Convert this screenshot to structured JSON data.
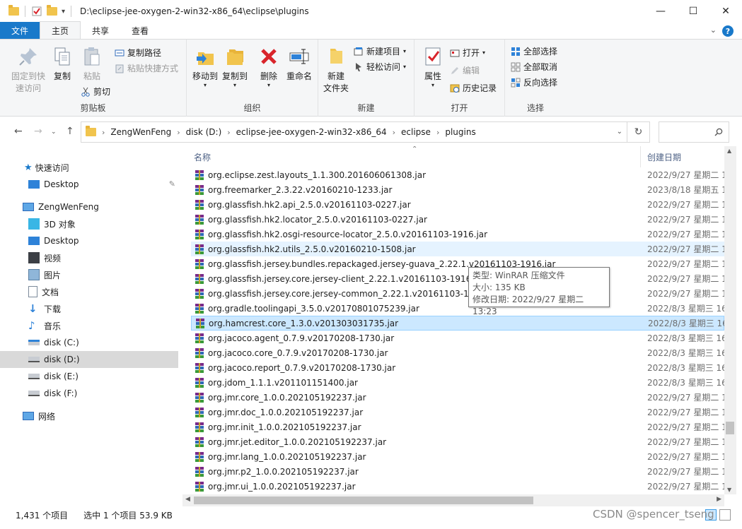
{
  "window": {
    "path": "D:\\eclipse-jee-oxygen-2-win32-x86_64\\eclipse\\plugins",
    "minimize": "—",
    "maximize": "☐",
    "close": "✕"
  },
  "tabs": {
    "file": "文件",
    "home": "主页",
    "share": "共享",
    "view": "查看",
    "help": "?"
  },
  "ribbon": {
    "clipboard": {
      "title": "剪贴板",
      "pin_line1": "固定到快",
      "pin_line2": "速访问",
      "copy": "复制",
      "paste": "粘贴",
      "copy_path": "复制路径",
      "paste_shortcut": "粘贴快捷方式",
      "cut": "剪切"
    },
    "organize": {
      "title": "组织",
      "move_to": "移动到",
      "copy_to": "复制到",
      "delete": "删除",
      "rename": "重命名"
    },
    "new": {
      "title": "新建",
      "new_folder_line1": "新建",
      "new_folder_line2": "文件夹",
      "new_item": "新建项目",
      "easy_access": "轻松访问"
    },
    "open": {
      "title": "打开",
      "properties": "属性",
      "open": "打开",
      "edit": "编辑",
      "history": "历史记录"
    },
    "select": {
      "title": "选择",
      "select_all": "全部选择",
      "select_none": "全部取消",
      "invert": "反向选择"
    }
  },
  "address": {
    "crumbs": [
      "ZengWenFeng",
      "disk (D:)",
      "eclipse-jee-oxygen-2-win32-x86_64",
      "eclipse",
      "plugins"
    ],
    "search_placeholder": ""
  },
  "nav": {
    "quick_access": "快速访问",
    "desktop_pinned": "Desktop",
    "this_pc": "ZengWenFeng",
    "objects3d": "3D 对象",
    "desktop": "Desktop",
    "videos": "视频",
    "pictures": "图片",
    "documents": "文档",
    "downloads": "下载",
    "music": "音乐",
    "disk_c": "disk (C:)",
    "disk_d": "disk (D:)",
    "disk_e": "disk (E:)",
    "disk_f": "disk (F:)",
    "network": "网络"
  },
  "columns": {
    "name": "名称",
    "created": "创建日期"
  },
  "files": [
    {
      "name": "org.eclipse.zest.layouts_1.1.300.201606061308.jar",
      "date": "2022/9/27 星期二 1"
    },
    {
      "name": "org.freemarker_2.3.22.v20160210-1233.jar",
      "date": "2023/8/18 星期五 1"
    },
    {
      "name": "org.glassfish.hk2.api_2.5.0.v20161103-0227.jar",
      "date": "2022/9/27 星期二 1"
    },
    {
      "name": "org.glassfish.hk2.locator_2.5.0.v20161103-0227.jar",
      "date": "2022/9/27 星期二 1"
    },
    {
      "name": "org.glassfish.hk2.osgi-resource-locator_2.5.0.v20161103-1916.jar",
      "date": "2022/9/27 星期二 1"
    },
    {
      "name": "org.glassfish.hk2.utils_2.5.0.v20160210-1508.jar",
      "date": "2022/9/27 星期二 1"
    },
    {
      "name": "org.glassfish.jersey.bundles.repackaged.jersey-guava_2.22.1.v20161103-1916.jar",
      "date": "2022/9/27 星期二 1"
    },
    {
      "name": "org.glassfish.jersey.core.jersey-client_2.22.1.v20161103-1916.jar",
      "date": "2022/9/27 星期二 1"
    },
    {
      "name": "org.glassfish.jersey.core.jersey-common_2.22.1.v20161103-1916.jar",
      "date": "2022/9/27 星期二 1"
    },
    {
      "name": "org.gradle.toolingapi_3.5.0.v20170801075239.jar",
      "date": "2022/8/3 星期三 16"
    },
    {
      "name": "org.hamcrest.core_1.3.0.v201303031735.jar",
      "date": "2022/8/3 星期三 16"
    },
    {
      "name": "org.jacoco.agent_0.7.9.v20170208-1730.jar",
      "date": "2022/8/3 星期三 16"
    },
    {
      "name": "org.jacoco.core_0.7.9.v20170208-1730.jar",
      "date": "2022/8/3 星期三 16"
    },
    {
      "name": "org.jacoco.report_0.7.9.v20170208-1730.jar",
      "date": "2022/8/3 星期三 16"
    },
    {
      "name": "org.jdom_1.1.1.v201101151400.jar",
      "date": "2022/8/3 星期三 16"
    },
    {
      "name": "org.jmr.core_1.0.0.202105192237.jar",
      "date": "2022/9/27 星期二 1"
    },
    {
      "name": "org.jmr.doc_1.0.0.202105192237.jar",
      "date": "2022/9/27 星期二 1"
    },
    {
      "name": "org.jmr.init_1.0.0.202105192237.jar",
      "date": "2022/9/27 星期二 1"
    },
    {
      "name": "org.jmr.jet.editor_1.0.0.202105192237.jar",
      "date": "2022/9/27 星期二 1"
    },
    {
      "name": "org.jmr.lang_1.0.0.202105192237.jar",
      "date": "2022/9/27 星期二 1"
    },
    {
      "name": "org.jmr.p2_1.0.0.202105192237.jar",
      "date": "2022/9/27 星期二 1"
    },
    {
      "name": "org.jmr.ui_1.0.0.202105192237.jar",
      "date": "2022/9/27 星期二 1"
    }
  ],
  "tooltip": {
    "type": "类型: WinRAR 压缩文件",
    "size": "大小: 135 KB",
    "modified": "修改日期: 2022/9/27 星期二 13:23"
  },
  "status": {
    "count": "1,431 个项目",
    "selection": "选中 1 个项目  53.9 KB"
  },
  "watermark": "CSDN @spencer_tseng",
  "colors": {
    "accent": "#1979ca",
    "selected_row": "#cce8ff",
    "hover_row": "#e5f3ff"
  }
}
